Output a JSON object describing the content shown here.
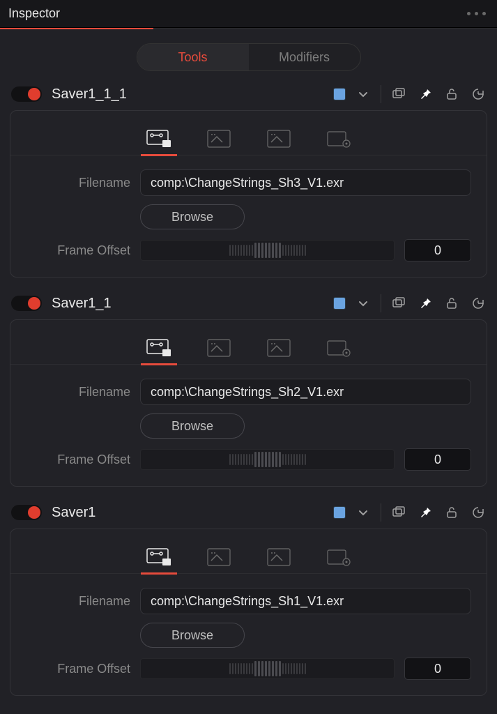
{
  "panel": {
    "title": "Inspector"
  },
  "tabs": {
    "tools": "Tools",
    "modifiers": "Modifiers"
  },
  "labels": {
    "filename": "Filename",
    "browse": "Browse",
    "frame_offset": "Frame Offset"
  },
  "colors": {
    "chip": "#6aa3e0",
    "accent": "#e64b3c"
  },
  "nodes": [
    {
      "name": "Saver1_1_1",
      "enabled": true,
      "filename": "comp:\\ChangeStrings_Sh3_V1.exr",
      "frame_offset": "0"
    },
    {
      "name": "Saver1_1",
      "enabled": true,
      "filename": "comp:\\ChangeStrings_Sh2_V1.exr",
      "frame_offset": "0"
    },
    {
      "name": "Saver1",
      "enabled": true,
      "filename": "comp:\\ChangeStrings_Sh1_V1.exr",
      "frame_offset": "0"
    }
  ]
}
